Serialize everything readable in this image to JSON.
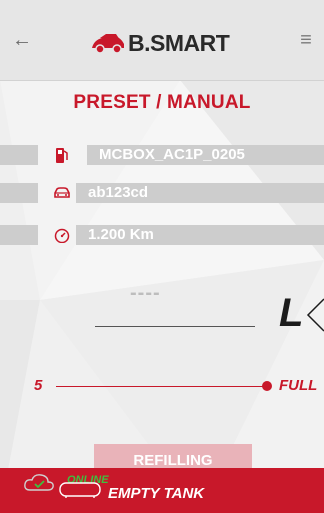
{
  "header": {
    "back_icon": "arrow-left-icon",
    "menu_icon": "hamburger-menu-icon",
    "logo_text": "B.SMART"
  },
  "page": {
    "title": "PRESET / MANUAL"
  },
  "info": {
    "dispenser": {
      "icon": "fuel-pump-icon",
      "value": "MCBOX_AC1P_0205"
    },
    "vehicle": {
      "icon": "car-icon",
      "value": "ab123cd"
    },
    "odometer": {
      "icon": "speedometer-icon",
      "value": "1.200 Km"
    }
  },
  "quantity": {
    "value": "----",
    "unit": "L"
  },
  "slider": {
    "min_label": "5",
    "max_label": "FULL",
    "level": 1.0
  },
  "actions": {
    "refill_label": "REFILLING"
  },
  "status": {
    "connection": "ONLINE",
    "tank": "EMPTY TANK"
  },
  "colors": {
    "accent": "#c8182a",
    "header_bg": "#e6e6e6",
    "bar_bg": "#cdcdcd",
    "online": "#3fbf3f"
  }
}
